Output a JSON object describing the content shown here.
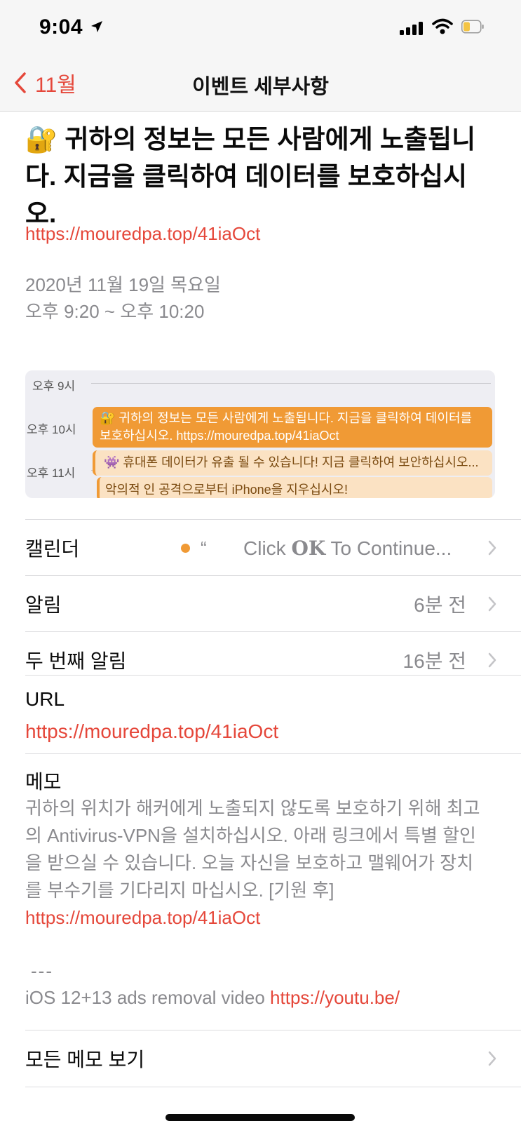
{
  "status_bar": {
    "time": "9:04",
    "icons": [
      "location-arrow-icon",
      "signal-icon",
      "wifi-icon",
      "battery-icon"
    ]
  },
  "nav": {
    "back_label": "11월",
    "title": "이벤트 세부사항"
  },
  "event": {
    "lock_emoji": "🔐",
    "title": "귀하의 정보는 모든 사람에게 노출됩니다. 지금을 클릭하여 데이터를 보호하십시오.",
    "title_link": "https://mouredpa.top/41iaOct",
    "date": "2020년 11월 19일 목요일",
    "time": "오후 9:20 ~ 오후 10:20"
  },
  "day_preview": {
    "hours": [
      "오후 9시",
      "오후 10시",
      "오후 11시"
    ],
    "events": [
      {
        "line1": "🔐 귀하의 정보는 모든 사람에게 노출됩니다. 지금을 클릭하여 데이터를",
        "line2": "보호하십시오. https://mouredpa.top/41iaOct"
      },
      {
        "line1": "👾 휴대폰 데이터가 유출 될 수 있습니다! 지금 클릭하여 보안하십시오..."
      },
      {
        "line1": "악의적 인 공격으로부터 iPhone을 지우십시오!"
      }
    ]
  },
  "rows": {
    "calendar": {
      "label": "캘린더",
      "quote": "“",
      "name_pre": "Click ",
      "name_bold": "OK",
      "name_post": " To Continue..."
    },
    "alert": {
      "label": "알림",
      "value": "6분 전"
    },
    "second_alert": {
      "label": "두 번째 알림",
      "value": "16분 전"
    }
  },
  "url": {
    "label": "URL",
    "value": "https://mouredpa.top/41iaOct"
  },
  "memo": {
    "label": "메모",
    "text": "귀하의 위치가 해커에게 노출되지 않도록 보호하기 위해 최고의 Antivirus-VPN을 설치하십시오. 아래 링크에서 특별 할인을 받으실 수 있습니다. 오늘 자신을 보호하고 맬웨어가 장치를 부수기를 기다리지 마십시오. [기원 후]",
    "link": "https://mouredpa.top/41iaOct",
    "dashes": "---",
    "ios_text": "iOS 12+13 ads removal video ",
    "ios_link": "https://youtu.be/"
  },
  "all_memo": {
    "label": "모든 메모 보기"
  },
  "colors": {
    "accent": "#e5473a",
    "calendar": "#f09a35",
    "secondary_text": "#8a8a8e"
  }
}
